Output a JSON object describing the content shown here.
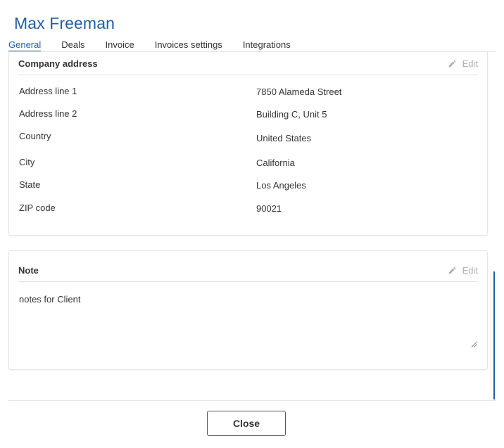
{
  "header": {
    "title": "Max Freeman"
  },
  "tabs": [
    {
      "label": "General",
      "active": true
    },
    {
      "label": "Deals"
    },
    {
      "label": "Invoice"
    },
    {
      "label": "Invoices settings"
    },
    {
      "label": "Integrations"
    }
  ],
  "company_address": {
    "title": "Company address",
    "edit_label": "Edit",
    "rows": [
      {
        "label": "Address line 1",
        "value": "7850 Alameda Street"
      },
      {
        "label": "Address line 2",
        "value": "Building C, Unit 5"
      },
      {
        "label": "Country",
        "value": "United States"
      },
      {
        "label": "City",
        "value": "California"
      },
      {
        "label": "State",
        "value": "Los Angeles"
      },
      {
        "label": "ZIP code",
        "value": "90021"
      }
    ]
  },
  "note": {
    "title": "Note",
    "edit_label": "Edit",
    "text": "notes for Client"
  },
  "footer": {
    "close_label": "Close"
  },
  "colors": {
    "accent": "#1f5fa6",
    "muted": "#b0b0b0"
  },
  "icons": {
    "edit": "pencil-icon",
    "resize": "resize-handle-icon"
  }
}
